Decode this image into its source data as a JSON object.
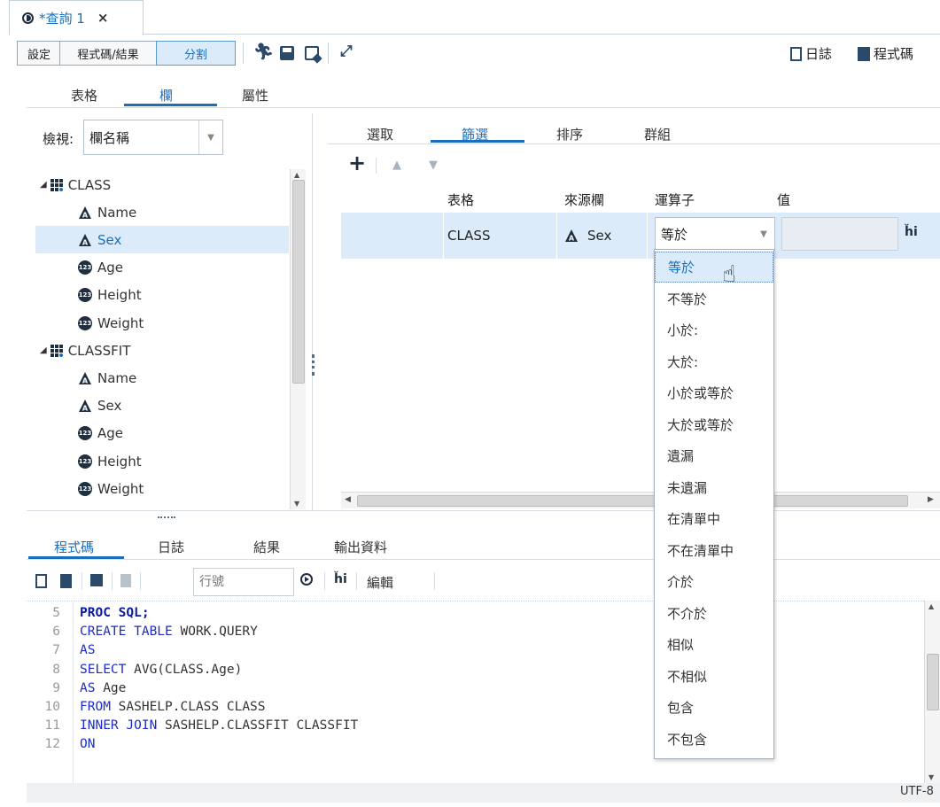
{
  "tab": {
    "title": "*查詢 1",
    "close": "×"
  },
  "toolbar": {
    "settings": "設定",
    "code_results": "程式碼/結果",
    "split": "分割",
    "log": "日誌",
    "code": "程式碼"
  },
  "subtabs": {
    "tables": "表格",
    "columns": "欄",
    "properties": "屬性"
  },
  "view": {
    "label": "檢視:",
    "selected": "欄名稱"
  },
  "tree": {
    "tables": [
      {
        "name": "CLASS",
        "columns": [
          {
            "name": "Name",
            "type": "char"
          },
          {
            "name": "Sex",
            "type": "char"
          },
          {
            "name": "Age",
            "type": "num"
          },
          {
            "name": "Height",
            "type": "num"
          },
          {
            "name": "Weight",
            "type": "num"
          }
        ]
      },
      {
        "name": "CLASSFIT",
        "columns": [
          {
            "name": "Name",
            "type": "char"
          },
          {
            "name": "Sex",
            "type": "char"
          },
          {
            "name": "Age",
            "type": "num"
          },
          {
            "name": "Height",
            "type": "num"
          },
          {
            "name": "Weight",
            "type": "num"
          }
        ]
      }
    ]
  },
  "query_tabs": {
    "select": "選取",
    "filter": "篩選",
    "sort": "排序",
    "group": "群組"
  },
  "filter_grid": {
    "headers": {
      "table": "表格",
      "source": "來源欄",
      "operator": "運算子",
      "value": "值"
    },
    "row": {
      "table": "CLASS",
      "source": "Sex",
      "operator": "等於",
      "value": ""
    }
  },
  "operator_options": [
    "等於",
    "不等於",
    "小於:",
    "大於:",
    "小於或等於",
    "大於或等於",
    "遺漏",
    "未遺漏",
    "在清單中",
    "不在清單中",
    "介於",
    "不介於",
    "相似",
    "不相似",
    "包含",
    "不包含"
  ],
  "bottom_tabs": {
    "code": "程式碼",
    "log": "日誌",
    "results": "結果",
    "output": "輸出資料"
  },
  "code_toolbar": {
    "line_placeholder": "行號",
    "edit": "編輯"
  },
  "code_lines": [
    {
      "n": "5",
      "text": "PROC SQL;"
    },
    {
      "n": "6",
      "text": "CREATE TABLE WORK.QUERY"
    },
    {
      "n": "7",
      "text": "AS"
    },
    {
      "n": "8",
      "text": "SELECT AVG(CLASS.Age)"
    },
    {
      "n": "9",
      "text": "AS Age"
    },
    {
      "n": "10",
      "text": "FROM SASHELP.CLASS CLASS"
    },
    {
      "n": "11",
      "text": "INNER JOIN SASHELP.CLASSFIT CLASSFIT"
    },
    {
      "n": "12",
      "text": "ON"
    }
  ],
  "status": {
    "encoding": "UTF-8"
  },
  "colors": {
    "accent": "#1a6fbd",
    "selection": "#dcebfa",
    "keyword": "#1d2cc8"
  }
}
